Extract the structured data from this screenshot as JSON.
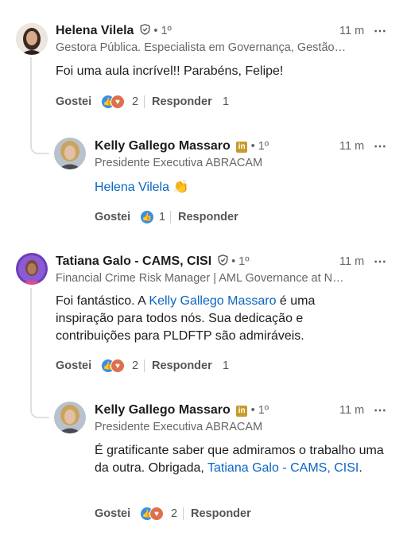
{
  "comments": [
    {
      "name": "Helena Vilela",
      "degree": "• 1º",
      "headline": "Gestora Pública. Especialista em Governança, Gestão…",
      "time": "11 m",
      "body": "Foi uma aula incrível!! Parabéns, Felipe!",
      "like_label": "Gostei",
      "reaction_count": "2",
      "reply_label": "Responder",
      "reply_count": "1",
      "reply": {
        "name": "Kelly Gallego Massaro",
        "degree": "• 1º",
        "badge": "in",
        "headline": "Presidente Executiva ABRACAM",
        "time": "11 m",
        "mention": "Helena Vilela",
        "emoji": "👏",
        "like_label": "Gostei",
        "reaction_count": "1",
        "reply_label": "Responder"
      }
    },
    {
      "name": "Tatiana Galo - CAMS, CISI",
      "degree": "• 1º",
      "headline": "Financial Crime Risk Manager | AML Governance at N…",
      "time": "11 m",
      "body_pre": "Foi fantástico. A ",
      "body_mention": "Kelly Gallego Massaro",
      "body_post": " é uma inspiração para todos nós. Sua dedicação e contribuições para PLDFTP são admiráveis.",
      "like_label": "Gostei",
      "reaction_count": "2",
      "reply_label": "Responder",
      "reply_count": "1",
      "reply": {
        "name": "Kelly Gallego Massaro",
        "degree": "• 1º",
        "badge": "in",
        "headline": "Presidente Executiva ABRACAM",
        "time": "11 m",
        "body_pre": "É gratificante saber que admiramos o trabalho uma da outra. Obrigada, ",
        "body_mention": "Tatiana Galo - CAMS, CISI",
        "body_post": ".",
        "like_label": "Gostei",
        "reaction_count": "2",
        "reply_label": "Responder"
      }
    }
  ],
  "more_icon": "⋯",
  "colors": {
    "link": "#0a66c2",
    "like": "#378fe9",
    "love": "#df704d",
    "premium_badge": "#c89b2b"
  }
}
